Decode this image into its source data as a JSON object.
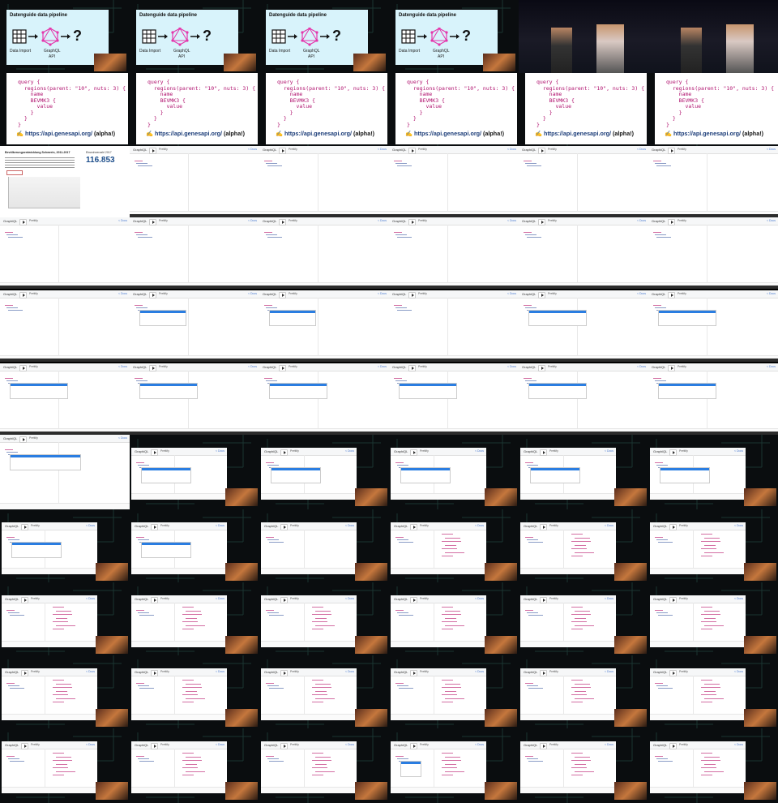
{
  "slide_pipeline": {
    "title": "Datenguide data pipeline",
    "import_label": "Data Import",
    "api_label_1": "GraphQL",
    "api_label_2": "API",
    "question": "?"
  },
  "slide_query": {
    "code_lines": [
      "query {",
      "  regions(parent: \"10\", nuts: 3) {",
      "    name",
      "    BEVMK3 {",
      "      value",
      "    }",
      "  }",
      "}"
    ],
    "link_url": "https://api.genesapi.org/",
    "link_note": "(alpha!)"
  },
  "graphiql": {
    "logo": "GraphiQL",
    "pretty": "Prettify",
    "docs": "< Docs"
  },
  "stats_slide": {
    "title": "Bevölkerungsentwicklung Schwerin, 2011-2017",
    "big_number": "116.853",
    "big_label": "Einwohnerzahl 2017"
  },
  "colors": {
    "slide_bg": "#d8f3fb",
    "accent_pink": "#e535ab",
    "link_blue": "#1b3c78",
    "selection_blue": "#2a7de1"
  }
}
